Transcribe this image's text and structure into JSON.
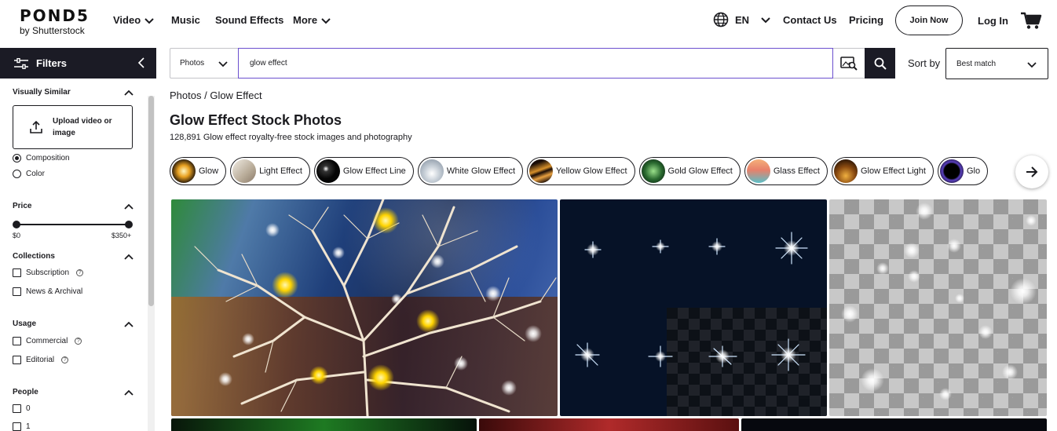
{
  "header": {
    "logo_main": "POND5",
    "logo_sub": "by Shutterstock",
    "nav": [
      "Video",
      "Music",
      "Sound Effects",
      "More"
    ],
    "language": "EN",
    "contact": "Contact Us",
    "pricing": "Pricing",
    "join": "Join Now",
    "login": "Log In"
  },
  "filters": {
    "title": "Filters",
    "visually_similar": {
      "title": "Visually Similar",
      "upload_label": "Upload video or image",
      "options": [
        "Composition",
        "Color"
      ],
      "selected": "Composition"
    },
    "price": {
      "title": "Price",
      "min": "$0",
      "max": "$350+"
    },
    "collections": {
      "title": "Collections",
      "options": [
        "Subscription",
        "News & Archival"
      ]
    },
    "usage": {
      "title": "Usage",
      "options": [
        "Commercial",
        "Editorial"
      ]
    },
    "people": {
      "title": "People",
      "options": [
        "0",
        "1"
      ]
    }
  },
  "search": {
    "type": "Photos",
    "query": "glow effect",
    "sort_label": "Sort by",
    "sort_value": "Best match"
  },
  "breadcrumb": {
    "root": "Photos",
    "separator": " / ",
    "current": "Glow Effect"
  },
  "page": {
    "title": "Glow Effect Stock Photos",
    "subtitle": "128,891 Glow effect royalty-free stock images and photography"
  },
  "chips": [
    {
      "label": "Glow",
      "color": "#e0a030"
    },
    {
      "label": "Light Effect",
      "color": "#d8cfc0"
    },
    {
      "label": "Glow Effect Line",
      "color": "#101010"
    },
    {
      "label": "White Glow Effect",
      "color": "#c8d0d8"
    },
    {
      "label": "Yellow Glow Effect",
      "color": "#2a1810"
    },
    {
      "label": "Gold Glow Effect",
      "color": "#2a6a30"
    },
    {
      "label": "Glass Effect",
      "color": "#e88a70"
    },
    {
      "label": "Glow Effect Light",
      "color": "#8a4a10"
    },
    {
      "label": "Glo",
      "color": "#1a1030"
    }
  ],
  "colors": {
    "dark": "#1b1b25",
    "input_focus": "#6b4fcf"
  }
}
